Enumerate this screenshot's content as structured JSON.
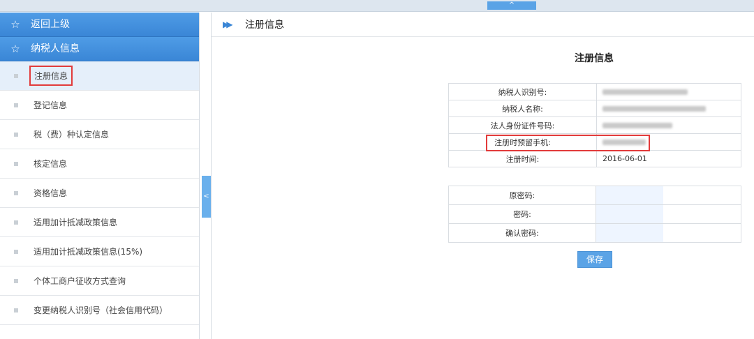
{
  "topbar": {
    "toggle_glyph": "^"
  },
  "sidebar": {
    "head_items": [
      {
        "icon": "star-outline-icon",
        "label": "返回上级"
      },
      {
        "icon": "star-outline-icon",
        "label": "纳税人信息"
      }
    ],
    "items": [
      {
        "label": "注册信息",
        "active": true
      },
      {
        "label": "登记信息"
      },
      {
        "label": "税（费）种认定信息"
      },
      {
        "label": "核定信息"
      },
      {
        "label": "资格信息"
      },
      {
        "label": "适用加计抵减政策信息"
      },
      {
        "label": "适用加计抵减政策信息(15%)"
      },
      {
        "label": "个体工商户征收方式查询"
      },
      {
        "label": "变更纳税人识别号（社会信用代码）"
      }
    ],
    "collapse_glyph": "<"
  },
  "content": {
    "breadcrumb": "注册信息",
    "title": "注册信息",
    "info_rows": [
      {
        "key": "纳税人识别号:",
        "value": ""
      },
      {
        "key": "纳税人名称:",
        "value": ""
      },
      {
        "key": "法人身份证件号码:",
        "value": ""
      },
      {
        "key": "注册时预留手机:",
        "value": ""
      },
      {
        "key": "注册时间:",
        "value": "2016-06-01"
      }
    ],
    "password_rows": [
      {
        "key": "原密码:"
      },
      {
        "key": "密码:"
      },
      {
        "key": "确认密码:"
      }
    ],
    "save_label": "保存"
  },
  "colors": {
    "accent": "#3a86d6",
    "highlight": "#e23b3b"
  }
}
